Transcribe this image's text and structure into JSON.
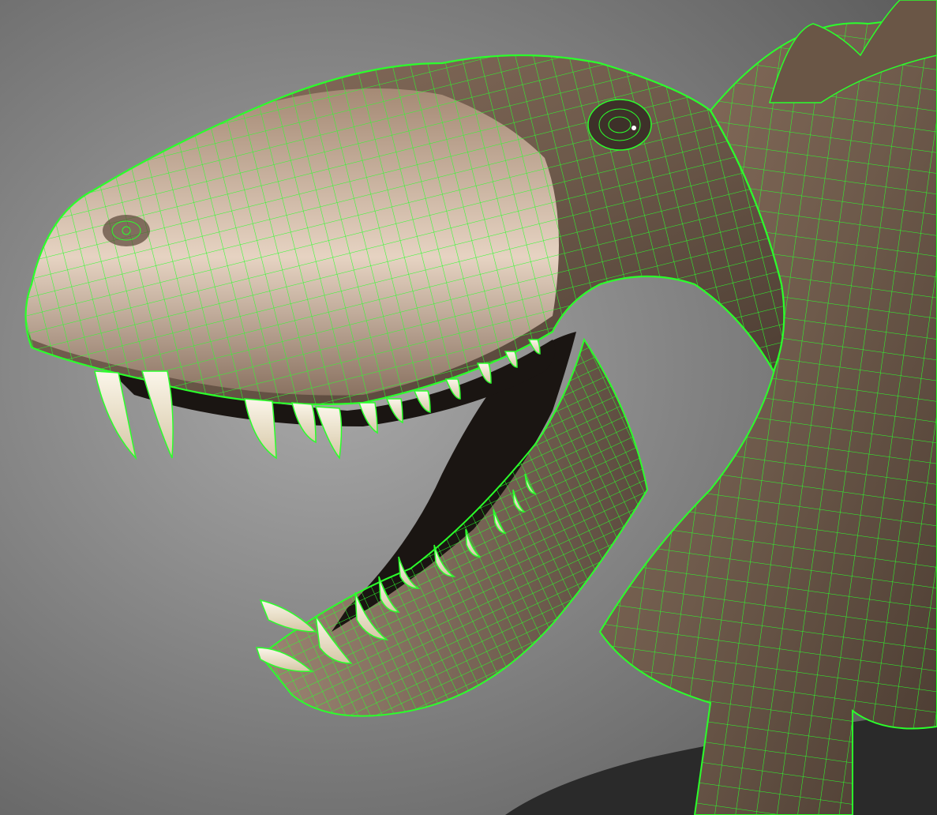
{
  "viewport": {
    "subject": "dinosaur-head-wireframe-overlay",
    "display_mode": "wireframe-on-shaded",
    "colors": {
      "background_light": "#a9a9a9",
      "background_dark": "#5a5a5a",
      "floor": "#2a2a2a",
      "skin_light": "#d9c2ad",
      "skin_mid": "#8c7462",
      "skin_dark": "#4a3b31",
      "mouth_interior": "#1a1512",
      "teeth": "#efe6d0",
      "wire": "#2bff2b"
    },
    "icons": [
      "eye-icon",
      "nostril-icon"
    ]
  }
}
